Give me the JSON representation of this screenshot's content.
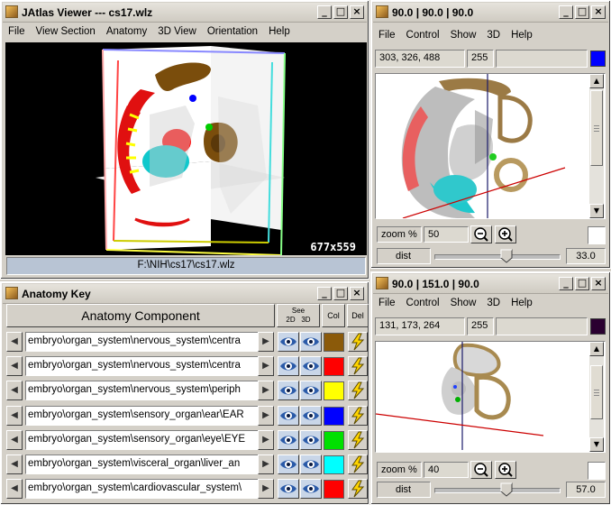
{
  "viewer": {
    "title": "JAtlas Viewer --- cs17.wlz",
    "menu": [
      "File",
      "View Section",
      "Anatomy",
      "3D View",
      "Orientation",
      "Help"
    ],
    "size_label": "677x559",
    "status_path": "F:\\NIH\\cs17\\cs17.wlz"
  },
  "section1": {
    "title": "90.0 | 90.0 | 90.0",
    "menu": [
      "File",
      "Control",
      "Show",
      "3D",
      "Help"
    ],
    "coords": "303, 326, 488",
    "value": "255",
    "swatch_color": "#0000ff",
    "zoom_label": "zoom %",
    "zoom_value": "50",
    "dist_label": "dist",
    "dist_value": "33.0",
    "dist_fraction": 0.58
  },
  "section2": {
    "title": "90.0 | 151.0 | 90.0",
    "menu": [
      "File",
      "Control",
      "Show",
      "3D",
      "Help"
    ],
    "coords": "131, 173, 264",
    "value": "255",
    "swatch_color": "#2a0030",
    "zoom_label": "zoom %",
    "zoom_value": "40",
    "dist_label": "dist",
    "dist_value": "57.0",
    "dist_fraction": 0.58
  },
  "anatomy": {
    "title": "Anatomy Key",
    "header_component": "Anatomy Component",
    "header_see": "See",
    "header_2d": "2D",
    "header_3d": "3D",
    "header_col": "Col",
    "header_del": "Del",
    "rows": [
      {
        "path": "embryo\\organ_system\\nervous_system\\centra",
        "color": "#8b5a0a"
      },
      {
        "path": "embryo\\organ_system\\nervous_system\\centra",
        "color": "#ff0000"
      },
      {
        "path": "embryo\\organ_system\\nervous_system\\periph",
        "color": "#ffff00"
      },
      {
        "path": "embryo\\organ_system\\sensory_organ\\ear\\EAR",
        "color": "#0000ff"
      },
      {
        "path": "embryo\\organ_system\\sensory_organ\\eye\\EYE",
        "color": "#00e000"
      },
      {
        "path": "embryo\\organ_system\\visceral_organ\\liver_an",
        "color": "#00ffff"
      },
      {
        "path": "embryo\\organ_system\\cardiovascular_system\\",
        "color": "#ff0000"
      }
    ]
  },
  "icons": {
    "window_control": [
      "minimize-icon",
      "maximize-icon",
      "close-icon"
    ],
    "zoom_out": "zoom-out-icon",
    "zoom_in": "zoom-in-icon",
    "eye": "eye-icon",
    "delete": "lightning-icon"
  }
}
